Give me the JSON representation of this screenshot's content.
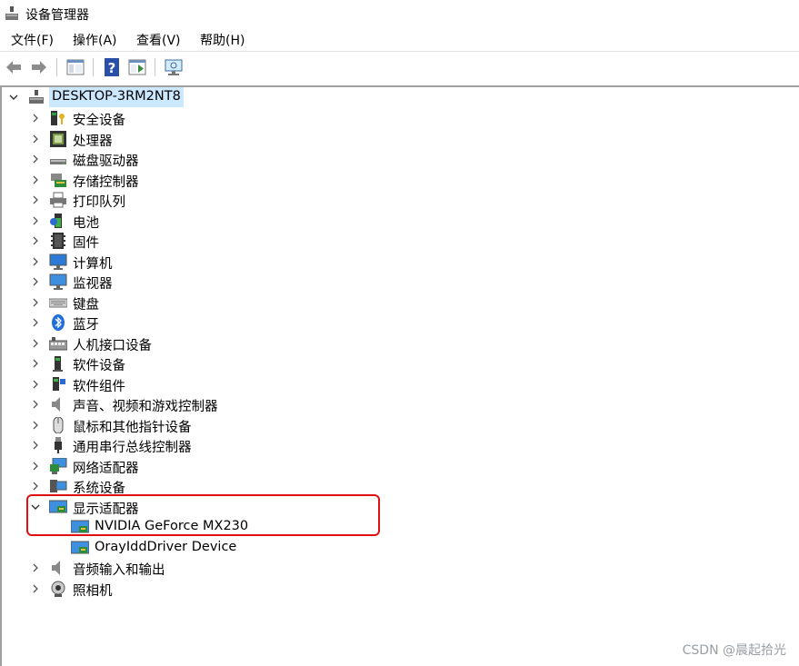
{
  "window": {
    "title": "设备管理器"
  },
  "menu": [
    "文件(F)",
    "操作(A)",
    "查看(V)",
    "帮助(H)"
  ],
  "toolbar": [
    "back-arrow-icon",
    "forward-arrow-icon",
    "show-hide-console-tree-icon",
    "help-icon",
    "properties-icon",
    "scan-hardware-icon"
  ],
  "tree": {
    "root": "DESKTOP-3RM2NT8",
    "categories": [
      {
        "label": "安全设备",
        "icon": "security-device-icon",
        "expanded": false
      },
      {
        "label": "处理器",
        "icon": "processor-icon",
        "expanded": false
      },
      {
        "label": "磁盘驱动器",
        "icon": "disk-drive-icon",
        "expanded": false
      },
      {
        "label": "存储控制器",
        "icon": "storage-controller-icon",
        "expanded": false
      },
      {
        "label": "打印队列",
        "icon": "printer-icon",
        "expanded": false
      },
      {
        "label": "电池",
        "icon": "battery-icon",
        "expanded": false
      },
      {
        "label": "固件",
        "icon": "firmware-icon",
        "expanded": false
      },
      {
        "label": "计算机",
        "icon": "computer-icon",
        "expanded": false
      },
      {
        "label": "监视器",
        "icon": "monitor-icon",
        "expanded": false
      },
      {
        "label": "键盘",
        "icon": "keyboard-icon",
        "expanded": false
      },
      {
        "label": "蓝牙",
        "icon": "bluetooth-icon",
        "expanded": false
      },
      {
        "label": "人机接口设备",
        "icon": "hid-icon",
        "expanded": false
      },
      {
        "label": "软件设备",
        "icon": "software-device-icon",
        "expanded": false
      },
      {
        "label": "软件组件",
        "icon": "software-component-icon",
        "expanded": false
      },
      {
        "label": "声音、视频和游戏控制器",
        "icon": "sound-icon",
        "expanded": false
      },
      {
        "label": "鼠标和其他指针设备",
        "icon": "mouse-icon",
        "expanded": false
      },
      {
        "label": "通用串行总线控制器",
        "icon": "usb-icon",
        "expanded": false
      },
      {
        "label": "网络适配器",
        "icon": "network-adapter-icon",
        "expanded": false
      },
      {
        "label": "系统设备",
        "icon": "system-device-icon",
        "expanded": false
      },
      {
        "label": "显示适配器",
        "icon": "display-adapter-icon",
        "expanded": true,
        "children": [
          "NVIDIA GeForce MX230",
          "OrayIddDriver Device"
        ]
      },
      {
        "label": "音频输入和输出",
        "icon": "audio-io-icon",
        "expanded": false
      },
      {
        "label": "照相机",
        "icon": "camera-icon",
        "expanded": false
      }
    ]
  },
  "watermark": "CSDN @晨起拾光",
  "colors": {
    "selection": "#cce8ff",
    "highlight_border": "#e01010",
    "monitor_blue": "#2b7bd6"
  }
}
